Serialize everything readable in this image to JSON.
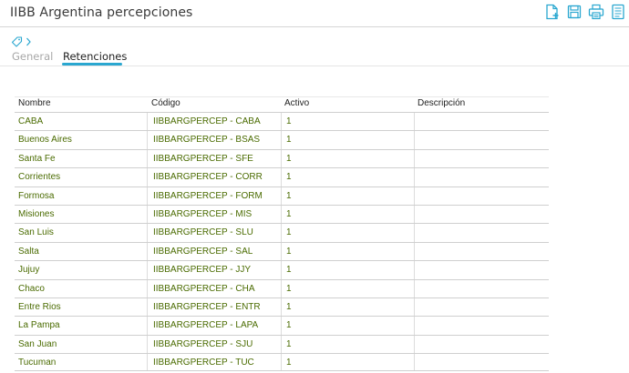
{
  "header": {
    "title": "IIBB Argentina percepciones"
  },
  "toolbar": {
    "new_icon": "new-document-icon",
    "save_icon": "save-icon",
    "print_icon": "print-icon",
    "list_icon": "list-icon",
    "accent_color": "#2aa7d0"
  },
  "breadcrumb": {
    "tag_icon": "tag-icon",
    "chevron_icon": "chevron-right-icon"
  },
  "tabs": [
    {
      "label": "General",
      "active": false
    },
    {
      "label": "Retenciones",
      "active": true
    }
  ],
  "table": {
    "columns": [
      "Nombre",
      "Código",
      "Activo",
      "Descripción"
    ],
    "rows": [
      {
        "nombre": "CABA",
        "codigo": "IIBBARGPERCEP - CABA",
        "activo": "1",
        "descripcion": ""
      },
      {
        "nombre": "Buenos Aires",
        "codigo": "IIBBARGPERCEP - BSAS",
        "activo": "1",
        "descripcion": ""
      },
      {
        "nombre": "Santa Fe",
        "codigo": "IIBBARGPERCEP - SFE",
        "activo": "1",
        "descripcion": ""
      },
      {
        "nombre": "Corrientes",
        "codigo": "IIBBARGPERCEP - CORR",
        "activo": "1",
        "descripcion": ""
      },
      {
        "nombre": "Formosa",
        "codigo": "IIBBARGPERCEP - FORM",
        "activo": "1",
        "descripcion": ""
      },
      {
        "nombre": "Misiones",
        "codigo": "IIBBARGPERCEP - MIS",
        "activo": "1",
        "descripcion": ""
      },
      {
        "nombre": "San Luis",
        "codigo": "IIBBARGPERCEP - SLU",
        "activo": "1",
        "descripcion": ""
      },
      {
        "nombre": "Salta",
        "codigo": "IIBBARGPERCEP - SAL",
        "activo": "1",
        "descripcion": ""
      },
      {
        "nombre": "Jujuy",
        "codigo": "IIBBARGPERCEP - JJY",
        "activo": "1",
        "descripcion": ""
      },
      {
        "nombre": "Chaco",
        "codigo": "IIBBARGPERCEP - CHA",
        "activo": "1",
        "descripcion": ""
      },
      {
        "nombre": "Entre Rios",
        "codigo": "IIBBARGPERCEP - ENTR",
        "activo": "1",
        "descripcion": ""
      },
      {
        "nombre": "La Pampa",
        "codigo": "IIBBARGPERCEP - LAPA",
        "activo": "1",
        "descripcion": ""
      },
      {
        "nombre": "San Juan",
        "codigo": "IIBBARGPERCEP - SJU",
        "activo": "1",
        "descripcion": ""
      },
      {
        "nombre": "Tucuman",
        "codigo": "IIBBARGPERCEP - TUC",
        "activo": "1",
        "descripcion": ""
      }
    ]
  },
  "colors": {
    "accent": "#2aa7d0",
    "cell_text": "#4a6b00",
    "grid_line": "#cfcfcf"
  }
}
